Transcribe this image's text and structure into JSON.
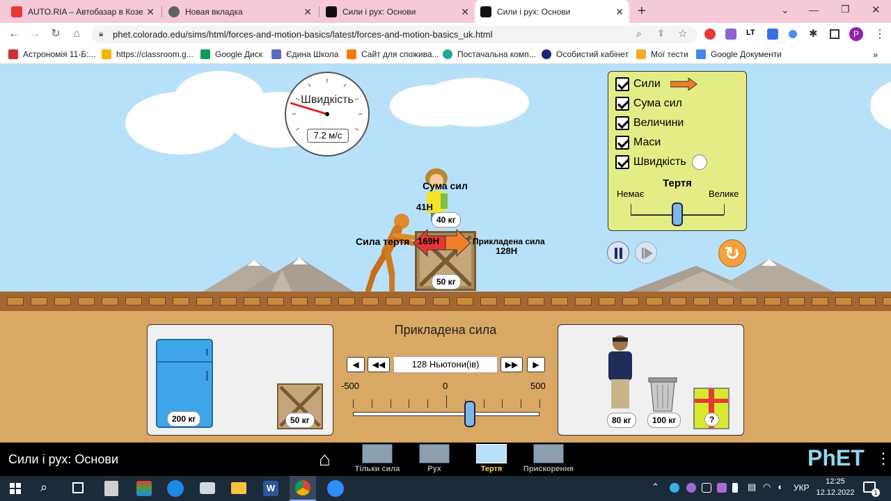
{
  "browser": {
    "tabs": [
      {
        "title": "AUTO.RIA – Автобазар в Козеле",
        "icon": "autoria-icon",
        "active": false
      },
      {
        "title": "Новая вкладка",
        "icon": "chrome-icon",
        "active": false
      },
      {
        "title": "Сили і рух: Основи",
        "icon": "phet-icon",
        "active": false
      },
      {
        "title": "Сили і рух: Основи",
        "icon": "phet-icon",
        "active": true
      }
    ],
    "url": "phet.colorado.edu/sims/html/forces-and-motion-basics/latest/forces-and-motion-basics_uk.html",
    "profile_initial": "P",
    "bookmarks": [
      {
        "label": "Астрономія 11-Б:...",
        "color": "#d32f2f"
      },
      {
        "label": "https://classroom.g...",
        "color": "#f4b400"
      },
      {
        "label": "Google Диск",
        "color": "#0f9d58"
      },
      {
        "label": "Єдина Школа",
        "color": "#5c6bc0"
      },
      {
        "label": "Сайт для спожива...",
        "color": "#f57c00"
      },
      {
        "label": "Постачальна комп...",
        "color": "#26a69a"
      },
      {
        "label": "Особистий кабінет",
        "color": "#1a237e"
      },
      {
        "label": "Мої тести",
        "color": "#f9a825"
      },
      {
        "label": "Google Документи",
        "color": "#4285f4"
      }
    ]
  },
  "sim": {
    "speedometer": {
      "title": "Швидкість",
      "value": "7.2 м/с"
    },
    "forces": {
      "sum_label": "Сума сил",
      "sum_value": "41Н",
      "friction_label": "Сила тертя",
      "friction_value": "169Н",
      "applied_label": "Прикладена сила",
      "applied_value": "128Н"
    },
    "stack_masses": {
      "top": "40 кг",
      "box": "50 кг"
    },
    "options": {
      "items": [
        {
          "label": "Сили",
          "checked": true
        },
        {
          "label": "Сума сил",
          "checked": true
        },
        {
          "label": "Величини",
          "checked": true
        },
        {
          "label": "Маси",
          "checked": true
        },
        {
          "label": "Швидкість",
          "checked": true
        }
      ],
      "friction_title": "Тертя",
      "friction_min": "Немає",
      "friction_max": "Велике",
      "friction_level": 0.5
    },
    "applied_force_panel": {
      "title": "Прикладена сила",
      "value": "128 Ньютони(ів)",
      "min": "-500",
      "mid": "0",
      "max": "500",
      "current": 128
    },
    "left_tray": [
      {
        "label": "200 кг",
        "object": "fridge"
      },
      {
        "label": "50 кг",
        "object": "crate"
      }
    ],
    "right_tray": [
      {
        "label": "80 кг",
        "object": "man"
      },
      {
        "label": "100 кг",
        "object": "trash-can"
      },
      {
        "label": "?",
        "object": "mystery-gift"
      }
    ],
    "title": "Сили і рух: Основи",
    "screens": [
      {
        "label": "Тільки сила",
        "active": false
      },
      {
        "label": "Рух",
        "active": false
      },
      {
        "label": "Тертя",
        "active": true
      },
      {
        "label": "Прискорення",
        "active": false
      }
    ],
    "brand": "PhET"
  },
  "taskbar": {
    "lang": "УКР",
    "time": "12:25",
    "date": "12.12.2022",
    "notifications": "1"
  },
  "colors": {
    "tab_bar": "#f6c9d8",
    "sky": "#b7e1fa",
    "control_bg": "#d8a864",
    "options_panel": "#e4ec86",
    "friction_arrow": "#e53935",
    "applied_arrow": "#f07f2a"
  }
}
